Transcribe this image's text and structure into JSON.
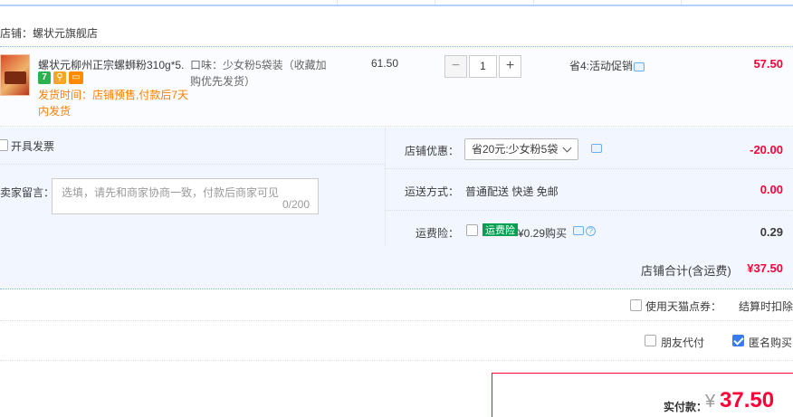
{
  "shop": {
    "name": "店铺：螺状元旗舰店"
  },
  "item": {
    "title": "螺状元柳州正宗螺蛳粉310g*5...",
    "ship_note": "发货时间：店铺预售,付款后7天内发货",
    "sku": "口味：少女粉5袋装（收藏加购优先发货）",
    "unit_price": "61.50",
    "quantity": "1",
    "qty_minus": "−",
    "qty_plus": "+",
    "promo": "省4:活动促销",
    "subtotal": "57.50",
    "badges": [
      {
        "text": "7",
        "color": "#2bb24c"
      },
      {
        "text": "",
        "color": "#f5a623"
      },
      {
        "text": "",
        "color": "#ff8a00"
      }
    ]
  },
  "options": {
    "invoice_label": "开具发票",
    "message_label": "给卖家留言：",
    "message_placeholder": "选填，请先和商家协商一致，付款后商家可见",
    "message_count": "0/200",
    "shop_coupon_label": "店铺优惠：",
    "shop_coupon_value": "省20元:少女粉5袋",
    "shop_coupon_amount": "-20.00",
    "shipping_label": "运送方式：",
    "shipping_value": "普通配送 快递 免邮",
    "shipping_amount": "0.00",
    "insurance_label": "运费险：",
    "insurance_tag": "运费险",
    "insurance_text": "¥0.29购买",
    "insurance_amount": "0.29"
  },
  "shop_total": {
    "label": "店铺合计(含运费)",
    "value": "¥37.50"
  },
  "tmall_points": {
    "label": "使用天猫点券：",
    "note": "结算时扣除"
  },
  "friend_pay": {
    "label": "朋友代付",
    "checked": false
  },
  "anonymous": {
    "label": "匿名购买",
    "checked": true
  },
  "payment": {
    "label": "实付款：",
    "currency": "¥",
    "amount": "37.50"
  },
  "colors": {
    "accent_red": "#ff0036",
    "border_blue": "#b2d1ff",
    "panel_bg": "#f2f7ff",
    "checkbox_blue": "#3a7bf2"
  },
  "icons": [
    "chat-icon",
    "help-icon",
    "chevron-down-icon",
    "checkbox-icon"
  ]
}
